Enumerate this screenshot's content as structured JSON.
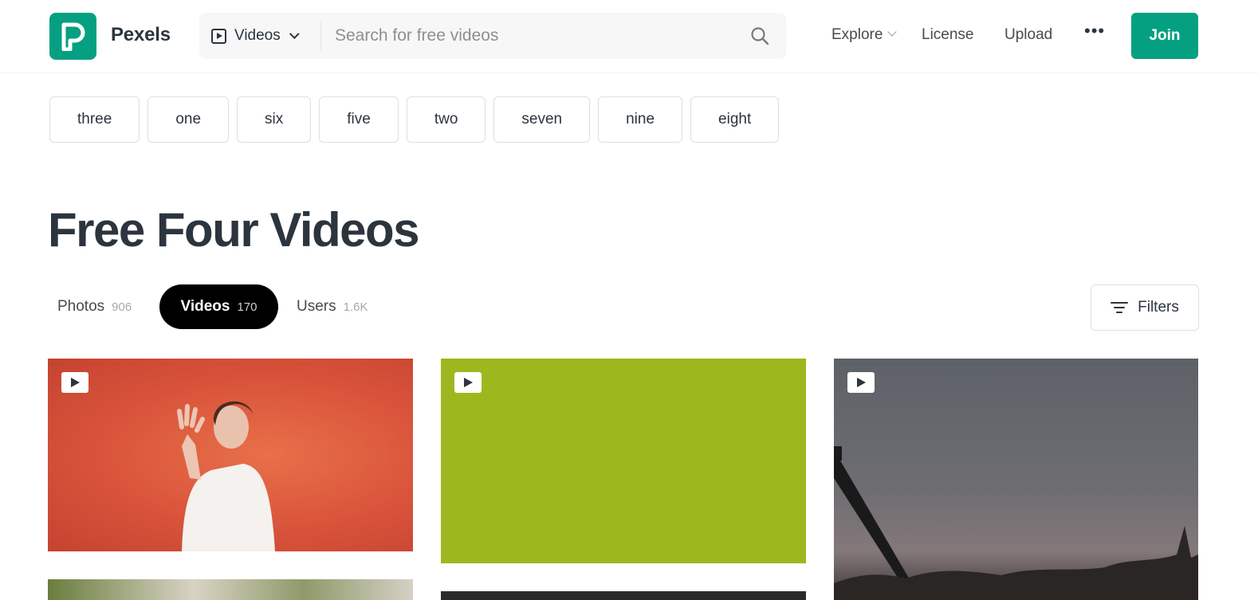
{
  "header": {
    "brand": "Pexels",
    "search": {
      "type_label": "Videos",
      "placeholder": "Search for free videos"
    },
    "nav": {
      "explore": "Explore",
      "license": "License",
      "upload": "Upload",
      "more": "•••",
      "join": "Join"
    }
  },
  "tags": [
    "three",
    "one",
    "six",
    "five",
    "two",
    "seven",
    "nine",
    "eight"
  ],
  "page_title": "Free Four Videos",
  "tabs": [
    {
      "label": "Photos",
      "count": "906"
    },
    {
      "label": "Videos",
      "count": "170"
    },
    {
      "label": "Users",
      "count": "1.6K"
    }
  ],
  "filters_label": "Filters",
  "colors": {
    "brand_green": "#05a081",
    "text_dark": "#2c343e",
    "active_tab": "#000000"
  }
}
